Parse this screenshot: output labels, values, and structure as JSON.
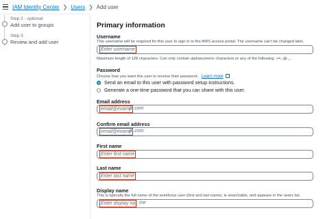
{
  "breadcrumb": {
    "items": [
      "IAM Identity Center",
      "Users",
      "Add user"
    ]
  },
  "steps": [
    {
      "label": "Step 2",
      "optional": "optional",
      "name": "Add user to groups"
    },
    {
      "label": "Step 3",
      "name": "Review and add user"
    }
  ],
  "form": {
    "title": "Primary information",
    "username": {
      "label": "Username",
      "description": "This username will be required for this user to sign in to the AWS access portal. The username can't be changed later.",
      "placeholder": "Enter username",
      "hint": "Maximum length of 128 characters. Can only contain alphanumeric characters or any of the following: +=,.@-_."
    },
    "password": {
      "label": "Password",
      "description": "Choose how you want this user to receive their password.",
      "learn_more": "Learn more",
      "options": [
        {
          "label": "Send an email to this user with password setup instructions.",
          "selected": true
        },
        {
          "label": "Generate a one-time password that you can share with this user.",
          "selected": false
        }
      ]
    },
    "email": {
      "label": "Email address",
      "placeholder_boxed": "email@examp",
      "placeholder_rest": "le.com"
    },
    "confirm_email": {
      "label": "Confirm email address",
      "placeholder_boxed": "email@examp",
      "placeholder_rest": "le.com"
    },
    "first_name": {
      "label": "First name",
      "placeholder": "Enter first name"
    },
    "last_name": {
      "label": "Last name",
      "placeholder": "Enter last name"
    },
    "display_name": {
      "label": "Display name",
      "description": "This is typically the full name of the workforce user (first and last name), is searchable, and appears in the users list.",
      "placeholder_boxed": "Enter display na",
      "placeholder_rest": "me"
    }
  },
  "colors": {
    "accent": "#0972d3",
    "highlight": "#d13212"
  }
}
